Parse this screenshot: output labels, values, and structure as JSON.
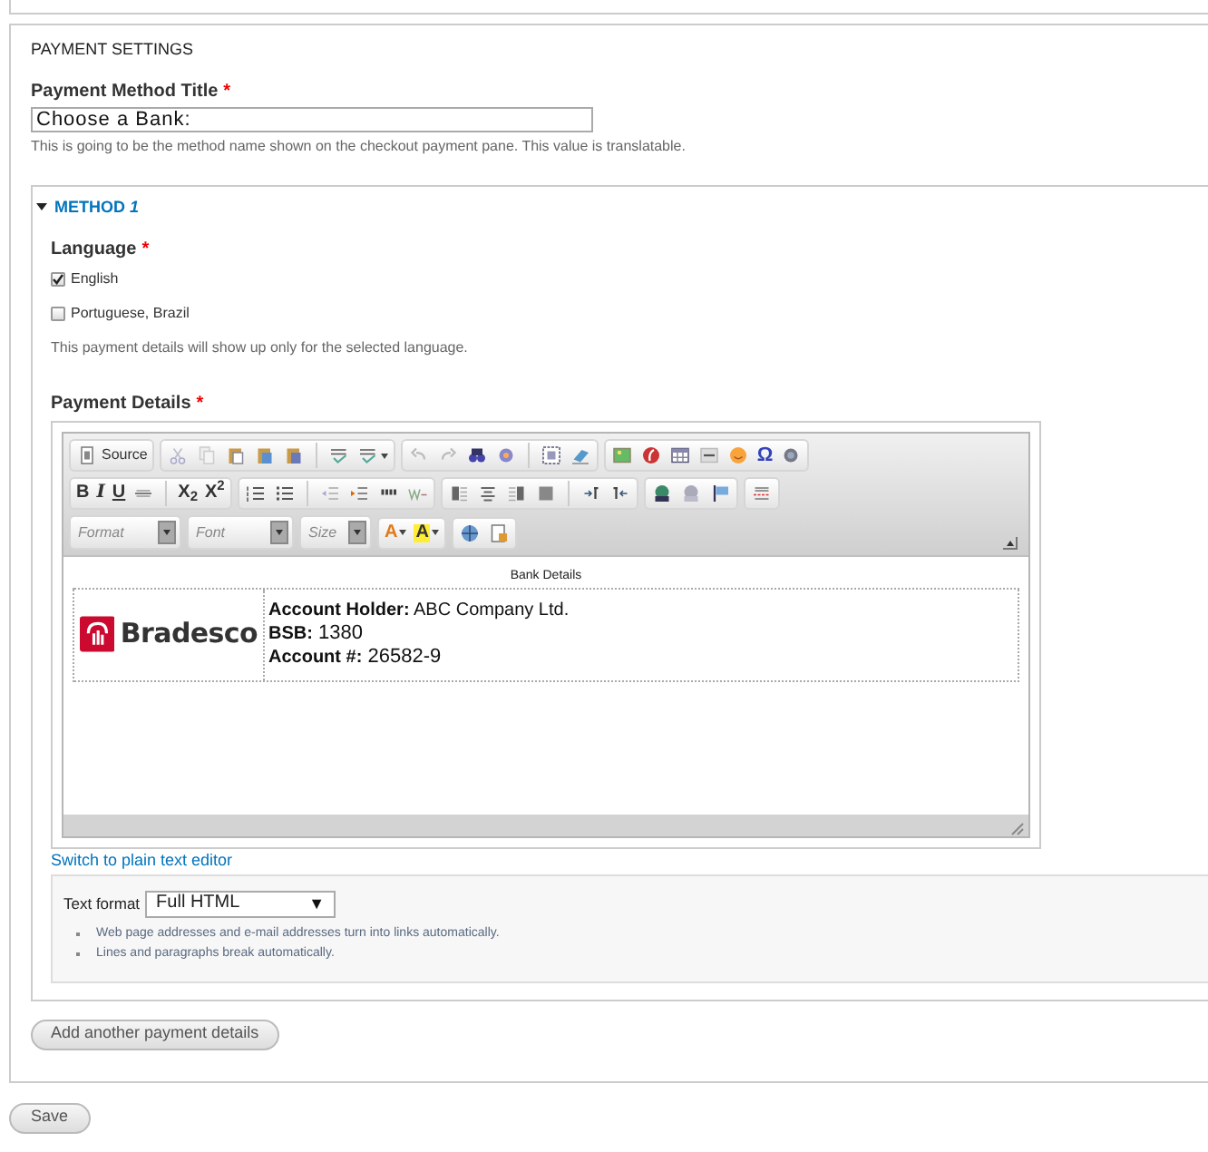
{
  "section_title": "PAYMENT SETTINGS",
  "title_field": {
    "label": "Payment Method Title",
    "required_mark": "*",
    "value": "Choose a Bank:",
    "description": "This is going to be the method name shown on the checkout payment pane. This value is translatable."
  },
  "method": {
    "legend": "METHOD *1*",
    "expanded": true,
    "language": {
      "label": "Language",
      "required_mark": "*",
      "options": [
        {
          "label": "English",
          "checked": true
        },
        {
          "label": "Portuguese, Brazil",
          "checked": false
        }
      ],
      "description": "This payment details will show up only for the selected language."
    },
    "payment_details": {
      "label": "Payment Details",
      "required_mark": "*",
      "toolbar": {
        "source": "Source",
        "bold": "B",
        "italic": "I",
        "underline": "U",
        "subscript": "X$_{2}$",
        "superscript": "X$^{2}$",
        "omega": "Ω",
        "format": "Format",
        "font": "Font",
        "size": "Size",
        "text_color": "A",
        "bg_color": "A"
      },
      "content": {
        "caption": "Bank Details",
        "logo_text": "Bradesco",
        "lines": [
          {
            "label": "Account Holder:",
            "value": "ABC Company Ltd."
          },
          {
            "label": "BSB:",
            "value": "1380"
          },
          {
            "label": "Account #:",
            "value": "26582-9"
          }
        ]
      },
      "switch_link": "Switch to plain text editor",
      "text_format": {
        "label": "Text format",
        "value": "Full HTML",
        "arrow": "▼",
        "tips": [
          "Web page addresses and e-mail addresses turn into links automatically.",
          "Lines and paragraphs break automatically."
        ]
      }
    }
  },
  "add_button": "Add another payment details",
  "save_button": "Save"
}
